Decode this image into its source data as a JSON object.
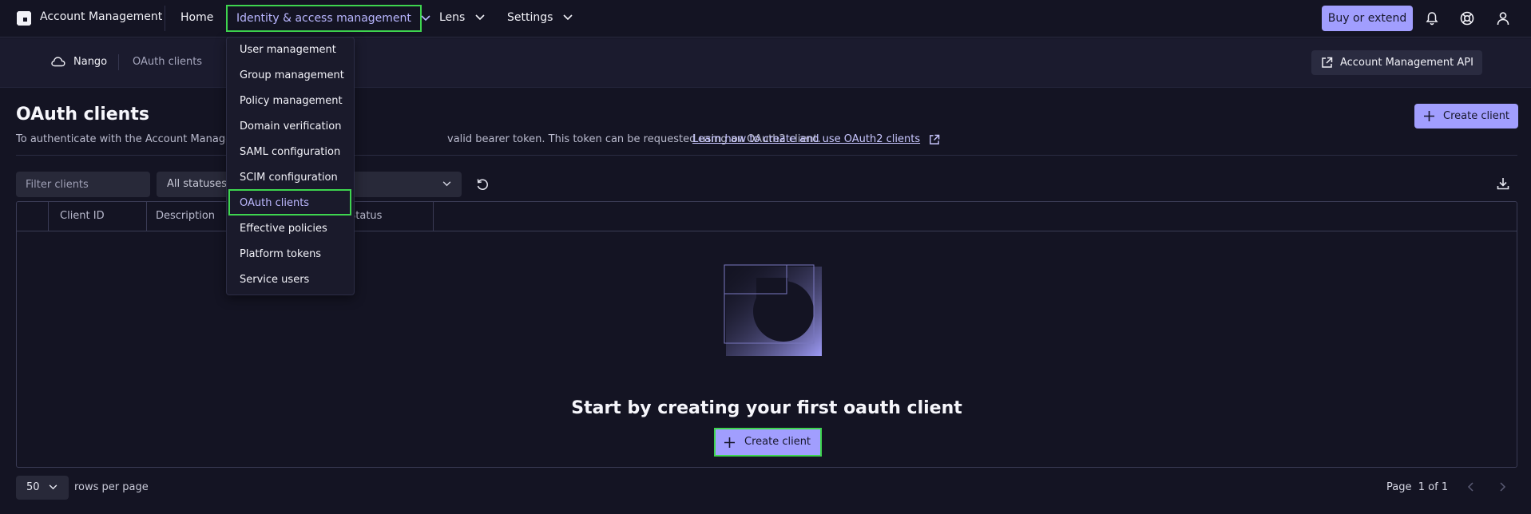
{
  "topbar": {
    "app_title": "Account Management",
    "nav": {
      "home": "Home",
      "iam": "Identity & access management",
      "lens": "Lens",
      "settings": "Settings"
    },
    "buy_button": "Buy or extend",
    "icons": [
      "logo-icon",
      "bell-icon",
      "help-icon",
      "user-icon"
    ]
  },
  "iam_menu": {
    "items": [
      "User management",
      "Group management",
      "Policy management",
      "Domain verification",
      "SAML configuration",
      "SCIM configuration",
      "OAuth clients",
      "Effective policies",
      "Platform tokens",
      "Service users"
    ],
    "selected": "OAuth clients"
  },
  "subheader": {
    "environment": "Nango",
    "current_page": "OAuth clients",
    "api_button": "Account Management API"
  },
  "page": {
    "title": "OAuth clients",
    "description_start": "To authenticate with the Account Manager",
    "description_end": "valid bearer token. This token can be requested using an OAuth2 client.",
    "learn_link": "Learn how to create and use OAuth2 clients",
    "create_button": "Create client"
  },
  "filters": {
    "filter_placeholder": "Filter clients",
    "status_value": "All statuses"
  },
  "table": {
    "columns": [
      "Client ID",
      "Description",
      "Status"
    ],
    "rows": [],
    "empty_title": "Start by creating your first oauth client",
    "empty_button": "Create client"
  },
  "pagination": {
    "rows_per_page_value": "50",
    "rows_per_page_label": "rows per page",
    "page_label": "Page",
    "page_value": "1 of 1"
  },
  "colors": {
    "background": "#141423",
    "accent": "#a19efe",
    "highlight_outline": "#3ed54f",
    "link": "#c9c7ff"
  }
}
